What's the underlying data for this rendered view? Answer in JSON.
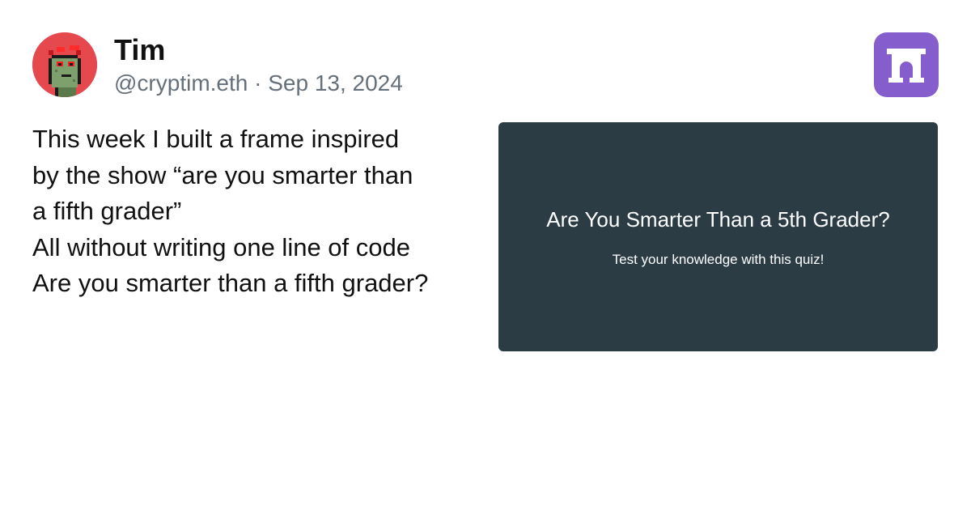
{
  "author": {
    "name": "Tim",
    "meta": "@cryptim.eth · Sep 13, 2024",
    "avatar_icon": "pixel-zombie-avatar-icon"
  },
  "brand": {
    "icon": "farcaster-arch-icon",
    "color": "#855dcd"
  },
  "post": {
    "lines": [
      "This week I built a frame inspired",
      "by the show “are you smarter than",
      "a fifth grader”",
      "All without writing one line of code",
      "Are you smarter than a fifth grader?"
    ]
  },
  "frame": {
    "title": "Are You Smarter Than a 5th Grader?",
    "subtitle": "Test your knowledge with this quiz!",
    "background_color": "#2c3c45"
  }
}
